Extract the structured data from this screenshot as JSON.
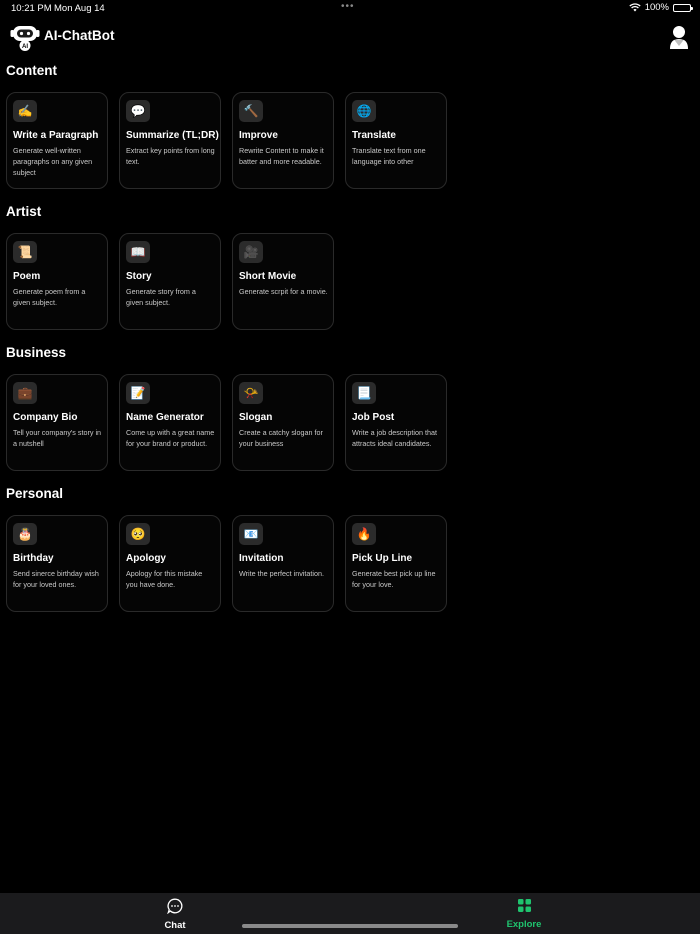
{
  "status": {
    "time": "10:21 PM",
    "date": "Mon Aug 14",
    "battery": "100%",
    "battery_level": 1.0
  },
  "header": {
    "title": "AI-ChatBot",
    "logo_badge": "AI"
  },
  "sections": [
    {
      "title": "Content",
      "cards": [
        {
          "icon": "✍️",
          "icon_name": "writing-hand-icon",
          "title": "Write a Paragraph",
          "desc": "Generate well-written paragraphs on any given subject"
        },
        {
          "icon": "💬",
          "icon_name": "speech-bubble-icon",
          "title": "Summarize (TL;DR)",
          "desc": "Extract key points from long text."
        },
        {
          "icon": "🔨",
          "icon_name": "hammer-icon",
          "title": "Improve",
          "desc": "Rewrite Content to make it batter and more readable."
        },
        {
          "icon": "🌐",
          "icon_name": "globe-icon",
          "title": "Translate",
          "desc": "Translate text from one language into other"
        }
      ]
    },
    {
      "title": "Artist",
      "cards": [
        {
          "icon": "📜",
          "icon_name": "scroll-icon",
          "title": "Poem",
          "desc": "Generate poem from a given subject."
        },
        {
          "icon": "📖",
          "icon_name": "open-book-icon",
          "title": "Story",
          "desc": "Generate story from a given subject."
        },
        {
          "icon": "🎥",
          "icon_name": "movie-camera-icon",
          "title": "Short Movie",
          "desc": "Generate scrpit for a movie."
        }
      ]
    },
    {
      "title": "Business",
      "cards": [
        {
          "icon": "💼",
          "icon_name": "briefcase-icon",
          "title": "Company Bio",
          "desc": "Tell your company's story in a nutshell"
        },
        {
          "icon": "📝",
          "icon_name": "memo-icon",
          "title": "Name Generator",
          "desc": "Come up with a great name for your brand or product."
        },
        {
          "icon": "📯",
          "icon_name": "horn-icon",
          "title": "Slogan",
          "desc": "Create a catchy slogan for your business"
        },
        {
          "icon": "📃",
          "icon_name": "document-icon",
          "title": "Job Post",
          "desc": "Write a job description that attracts ideal candidates."
        }
      ]
    },
    {
      "title": "Personal",
      "cards": [
        {
          "icon": "🎂",
          "icon_name": "birthday-cake-icon",
          "title": "Birthday",
          "desc": "Send sinerce birthday wish for your loved ones."
        },
        {
          "icon": "🥺",
          "icon_name": "pleading-face-icon",
          "title": "Apology",
          "desc": "Apology for this mistake you have done."
        },
        {
          "icon": "📧",
          "icon_name": "envelope-icon",
          "title": "Invitation",
          "desc": "Write the perfect invitation."
        },
        {
          "icon": "🔥",
          "icon_name": "fire-icon",
          "title": "Pick Up Line",
          "desc": "Generate best pick up line for your love."
        }
      ]
    }
  ],
  "tabs": {
    "chat": {
      "label": "Chat"
    },
    "explore": {
      "label": "Explore",
      "active_color": "#1fc36e"
    }
  }
}
